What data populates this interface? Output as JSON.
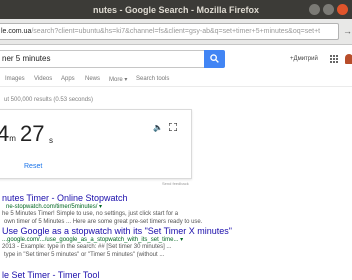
{
  "window": {
    "title": "nutes - Google Search - Mozilla Firefox"
  },
  "browser": {
    "url_host": "le.com.ua",
    "url_rest": "/search?client=ubuntu&hs=ki7&channel=fs&client=gsy-ab&q=set+timer+5+minutes&oq=set+t"
  },
  "search": {
    "query": "ner 5 minutes",
    "account": "+Дмитрий"
  },
  "tabs": [
    "Images",
    "Videos",
    "Apps",
    "News",
    "More ▾",
    "Search tools"
  ],
  "stats": "ut 500,000 results (0.53 seconds)",
  "timer": {
    "minutes": "4",
    "m_unit": "m",
    "seconds": "27",
    "s_unit": "s",
    "reset": "Reset",
    "feedback": "Send feedback"
  },
  "results": [
    {
      "title": "nutes Timer - Online Stopwatch",
      "url": "ne-stopwatch.com/timer/5minutes/ ▾",
      "snippets": [
        "he 5 Minutes Timer! Simple to use, no settings, just click start for a",
        "own timer of 5 Minutes ... Here are some great pre-set timers ready to use."
      ]
    },
    {
      "title": "Use Google as a stopwatch with its \"Set Timer X minutes\"",
      "url": "...google.com/.../use_google_as_a_stopwatch_with_its_set_time... ▾",
      "snippets": [
        "2013 - Example: type in the search: ## [Set timer 30 minutes] ...",
        "type in \"Set timer 5 minutes\" or \"Timer 5 minutes\" (without ..."
      ]
    },
    {
      "title": "le Set Timer - Timer Tool",
      "url": "",
      "snippets": []
    }
  ]
}
